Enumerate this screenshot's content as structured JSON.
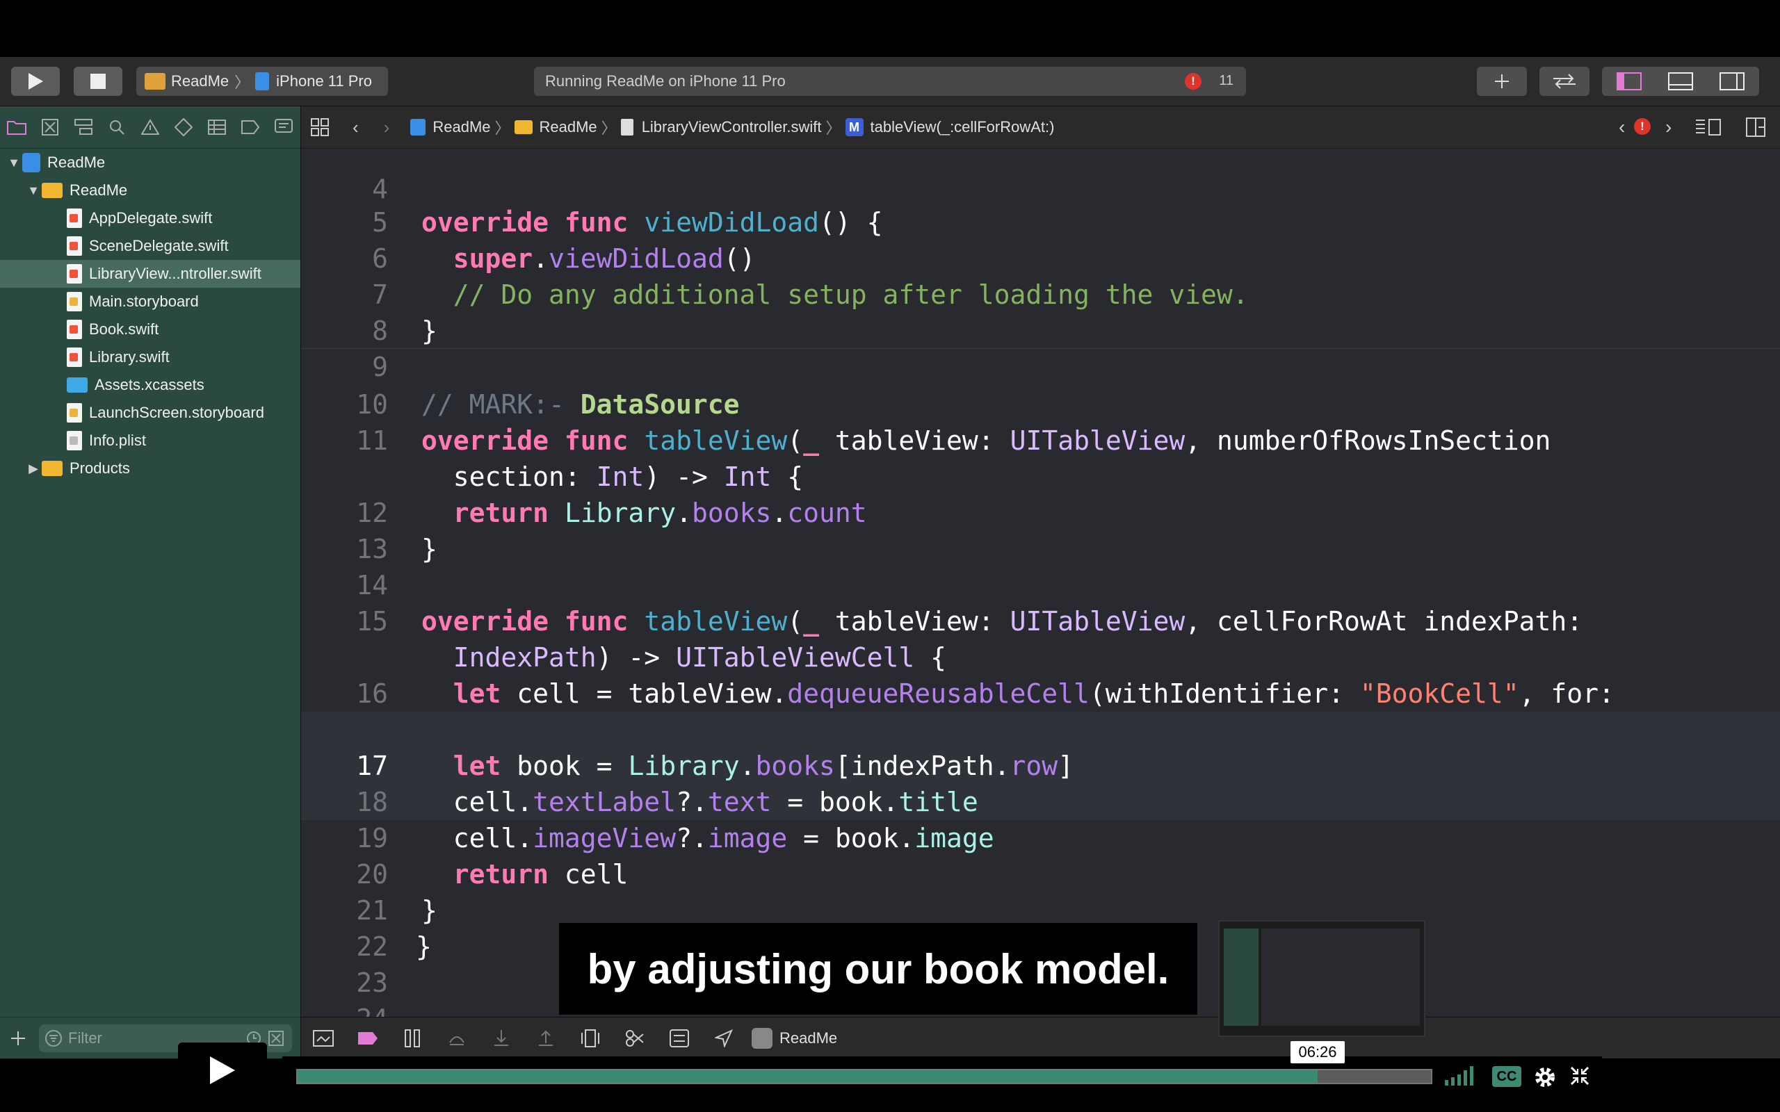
{
  "toolbar": {
    "scheme_app": "ReadMe",
    "scheme_device": "iPhone 11 Pro",
    "activity_text": "Running ReadMe on iPhone 11 Pro",
    "error_count": "11"
  },
  "navigator": {
    "items": [
      {
        "label": "ReadMe",
        "type": "project",
        "indent": 0,
        "disclosure": "▼"
      },
      {
        "label": "ReadMe",
        "type": "folder",
        "indent": 1,
        "disclosure": "▼"
      },
      {
        "label": "AppDelegate.swift",
        "type": "swift",
        "indent": 2
      },
      {
        "label": "SceneDelegate.swift",
        "type": "swift",
        "indent": 2
      },
      {
        "label": "LibraryView...ntroller.swift",
        "type": "swift",
        "indent": 2,
        "selected": true
      },
      {
        "label": "Main.storyboard",
        "type": "storyboard",
        "indent": 2
      },
      {
        "label": "Book.swift",
        "type": "swift",
        "indent": 2
      },
      {
        "label": "Library.swift",
        "type": "swift",
        "indent": 2
      },
      {
        "label": "Assets.xcassets",
        "type": "assets",
        "indent": 2
      },
      {
        "label": "LaunchScreen.storyboard",
        "type": "storyboard",
        "indent": 2
      },
      {
        "label": "Info.plist",
        "type": "plist",
        "indent": 2
      },
      {
        "label": "Products",
        "type": "folder",
        "indent": 1,
        "disclosure": "▶"
      }
    ],
    "filter_placeholder": "Filter"
  },
  "jumpbar": {
    "crumbs": [
      "ReadMe",
      "ReadMe",
      "LibraryViewController.swift",
      "tableView(_:cellForRowAt:)"
    ]
  },
  "editor": {
    "current_line": "17"
  },
  "debugbar": {
    "target": "ReadMe"
  },
  "subtitle": "by adjusting our book model.",
  "player": {
    "timecode": "06:26",
    "progress": 0.9,
    "cc_label": "CC"
  },
  "colors": {
    "navigator_bg": "#2b4a3f",
    "editor_bg": "#292a30",
    "keyword": "#ff7ab2",
    "progress_fill": "#3d8a74"
  }
}
